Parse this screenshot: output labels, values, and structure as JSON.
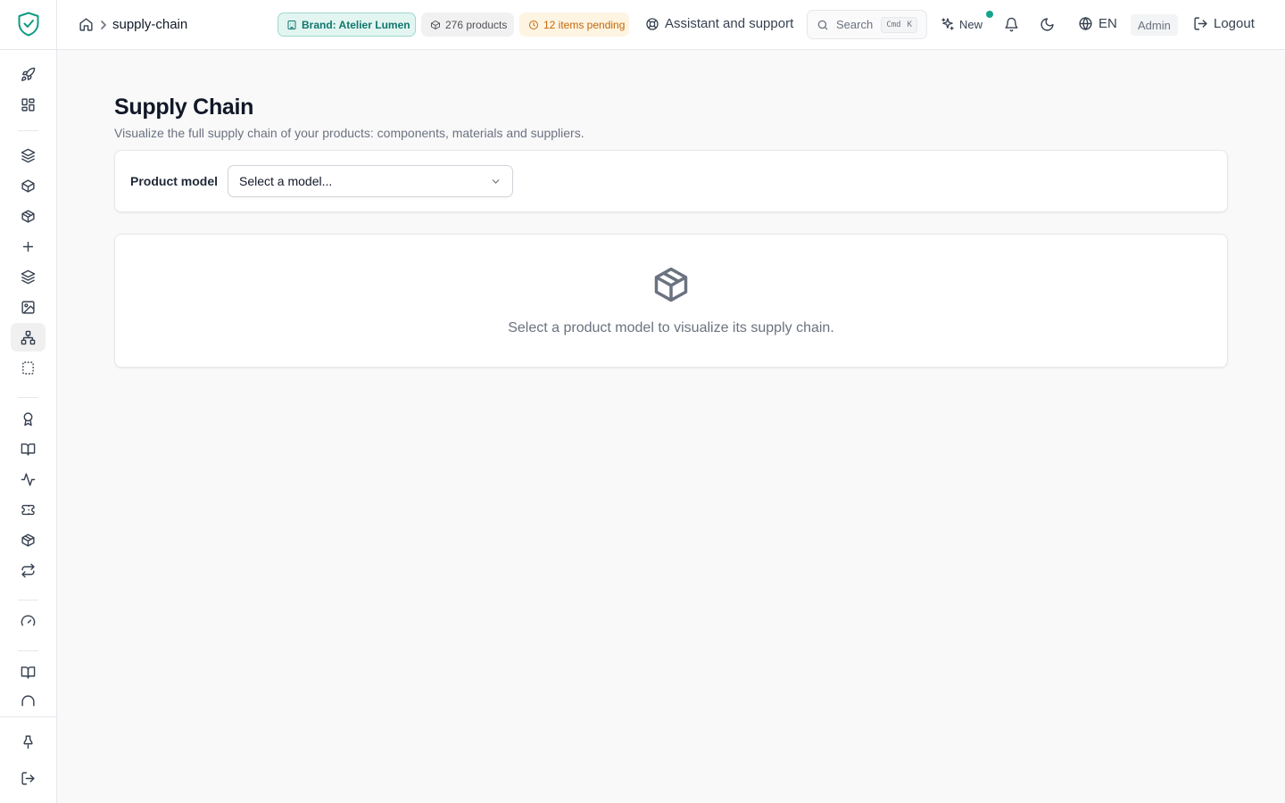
{
  "sidebar": {
    "logo_icon": "shield-check-icon",
    "items": [
      {
        "icon": "rocket-icon",
        "active": false
      },
      {
        "icon": "dashboard-grid-icon",
        "active": false
      },
      {
        "icon": "layers-icon",
        "active": false
      },
      {
        "icon": "box-icon",
        "active": false
      },
      {
        "icon": "box-outline-icon",
        "active": false
      },
      {
        "icon": "plus-icon",
        "active": false
      },
      {
        "icon": "layers-stack-icon",
        "active": false
      },
      {
        "icon": "image-icon",
        "active": false
      },
      {
        "icon": "hierarchy-icon",
        "active": true
      },
      {
        "icon": "dashed-frame-icon",
        "active": false
      },
      {
        "icon": "award-icon",
        "active": false
      },
      {
        "icon": "book-open-icon",
        "active": false
      },
      {
        "icon": "activity-icon",
        "active": false
      },
      {
        "icon": "ticket-icon",
        "active": false
      },
      {
        "icon": "package-icon",
        "active": false
      },
      {
        "icon": "repeat-icon",
        "active": false
      },
      {
        "icon": "gauge-icon",
        "active": false
      },
      {
        "icon": "book-icon",
        "active": false
      },
      {
        "icon": "headphones-icon",
        "active": false
      },
      {
        "icon": "pin-icon",
        "active": false
      },
      {
        "icon": "logout-icon",
        "active": false
      }
    ]
  },
  "header": {
    "breadcrumb": {
      "home_icon": "home-icon",
      "current": "supply-chain"
    },
    "brand_badge": "Brand: Atelier Lumen",
    "products_badge": "276 products",
    "pending_badge": "12 items pending",
    "assistant_label": "Assistant and support",
    "search": {
      "label": "Search",
      "kbd_mod": "Cmd",
      "kbd_key": "K"
    },
    "new_label": "New",
    "language": "EN",
    "role": "Admin",
    "logout_label": "Logout",
    "colors": {
      "accent": "#14a38b",
      "brand_badge_bg": "#e3f5f1",
      "pending_badge_bg": "#fef4e2"
    }
  },
  "main": {
    "title": "Supply Chain",
    "subtitle": "Visualize the full supply chain of your products: components, materials and suppliers.",
    "filter": {
      "label": "Product model",
      "select_value": "Select a model..."
    },
    "empty_state": {
      "icon": "package-icon",
      "message": "Select a product model to visualize its supply chain."
    }
  }
}
